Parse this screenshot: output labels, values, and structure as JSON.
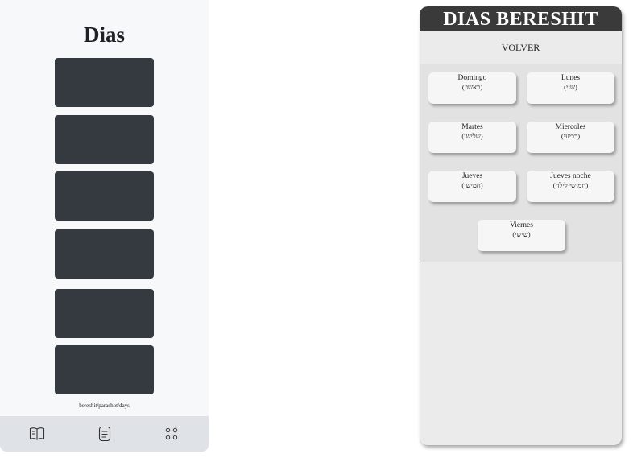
{
  "left_screen": {
    "title": "Dias",
    "card_count": 6,
    "route": "bereshit/parashot/days",
    "tabbar": {
      "items": [
        {
          "icon": "book-open-icon"
        },
        {
          "icon": "document-icon"
        },
        {
          "icon": "grid-dots-icon"
        }
      ]
    }
  },
  "right_screen": {
    "header_title": "DIAS BERESHIT",
    "back_label": "VOLVER",
    "days": [
      {
        "name": "Domingo",
        "hebrew": "(ראשון)"
      },
      {
        "name": "Lunes",
        "hebrew": "(שני)"
      },
      {
        "name": "Martes",
        "hebrew": "(שלישי)"
      },
      {
        "name": "Miercoles",
        "hebrew": "(רביעי)"
      },
      {
        "name": "Jueves",
        "hebrew": "(חמישי)"
      },
      {
        "name": "Jueves noche",
        "hebrew": "(חמישי לילה)"
      },
      {
        "name": "Viernes",
        "hebrew": "(שישי)"
      }
    ]
  },
  "colors": {
    "card_dark": "#343a40",
    "header_dark": "#3a3a3a",
    "tabbar_bg": "#dfe2e6"
  }
}
